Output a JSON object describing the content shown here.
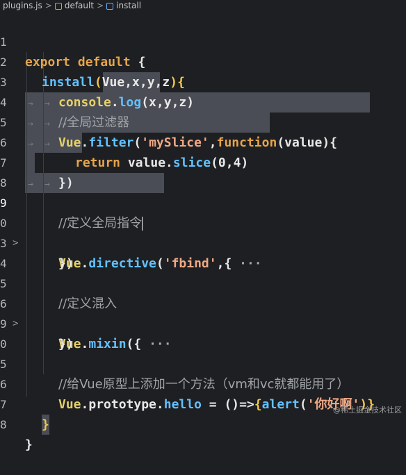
{
  "breadcrumb": {
    "file": "plugins.js",
    "symbol1": "default",
    "symbol2": "install"
  },
  "editor": {
    "lines": {
      "l1": {
        "num": "1",
        "a": "export default",
        "b": " {"
      },
      "l2": {
        "num": "2",
        "a": "install",
        "b": "(",
        "c": "Vue,x,y,z",
        "d": "){"
      },
      "l3": {
        "num": "3",
        "a": "console",
        "b": ".",
        "c": "log",
        "d": "(x,y,z)"
      },
      "l4": {
        "num": "4",
        "text": "//全局过滤器"
      },
      "l5": {
        "num": "5",
        "a": "Vue",
        "b": ".",
        "c": "filter",
        "d": "(",
        "e": "'mySlice'",
        "f": ",",
        "g": "function",
        "h": "(",
        "i": "value",
        "j": "){"
      },
      "l6": {
        "num": "6",
        "a": "return",
        "b": " value.",
        "c": "slice",
        "d": "(",
        "e": "0",
        "f": ",",
        "g": "4",
        "h": ")"
      },
      "l7": {
        "num": "7",
        "text": "})"
      },
      "l8": {
        "num": "8"
      },
      "l9": {
        "num": "9",
        "text": "//定义全局指令"
      },
      "l10": {
        "num": "0",
        "a": "Vue",
        "b": ".",
        "c": "directive",
        "d": "(",
        "e": "'fbind'",
        "f": ",{ ",
        "g": "···"
      },
      "l11": {
        "num": "3",
        "text": "})"
      },
      "l12": {
        "num": "4"
      },
      "l13": {
        "num": "5",
        "text": "//定义混入"
      },
      "l14": {
        "num": "6",
        "a": "Vue",
        "b": ".",
        "c": "mixin",
        "d": "({ ",
        "e": "···"
      },
      "l15": {
        "num": "9",
        "text": "})"
      },
      "l16": {
        "num": "0"
      },
      "l17": {
        "num": "5",
        "text": "//给Vue原型上添加一个方法（vm和vc就都能用了）"
      },
      "l18": {
        "num": "6",
        "a": "Vue",
        "b": ".",
        "c": "prototype",
        "d": ".",
        "e": "hello",
        "f": " = ",
        "g": "()=>",
        "h": "{",
        "i": "alert",
        "j": "(",
        "k": "'你好啊'",
        "l": ")}"
      },
      "l19": {
        "num": "7",
        "text": "}"
      },
      "l20": {
        "num": "8",
        "text": "}"
      }
    }
  },
  "watermark": "@稀土掘金技术社区",
  "colors": {
    "background": "#1e1f22",
    "selection": "#4a4d55",
    "keyword": "#e5a54b",
    "function": "#62c1ff",
    "string": "#f0a884",
    "comment": "#a0a4a8"
  }
}
